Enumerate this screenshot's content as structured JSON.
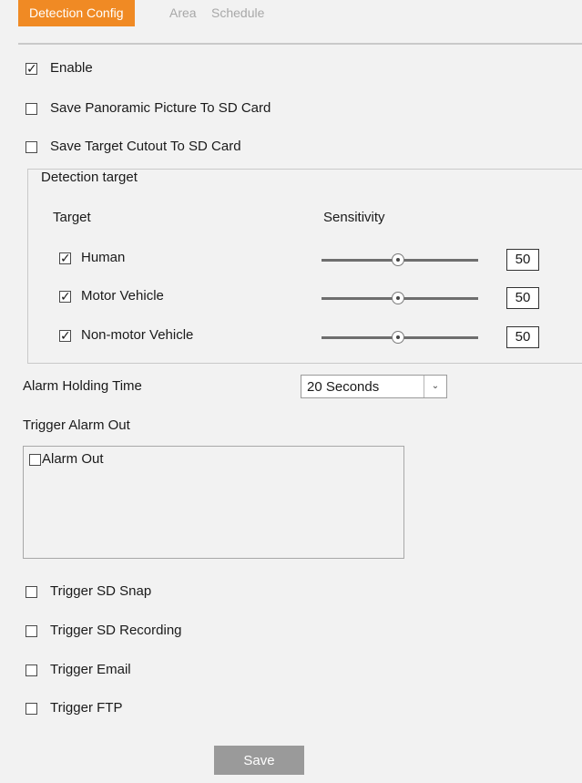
{
  "tabs": [
    {
      "label": "Detection Config",
      "active": true
    },
    {
      "label": "Area",
      "active": false
    },
    {
      "label": "Schedule",
      "active": false
    }
  ],
  "options": {
    "enable": {
      "label": "Enable",
      "checked": true
    },
    "save_panoramic": {
      "label": "Save Panoramic Picture To SD Card",
      "checked": false
    },
    "save_cutout": {
      "label": "Save Target Cutout To SD Card",
      "checked": false
    }
  },
  "detection": {
    "legend": "Detection target",
    "col_target": "Target",
    "col_sensitivity": "Sensitivity",
    "targets": [
      {
        "label": "Human",
        "checked": true,
        "sensitivity": "50"
      },
      {
        "label": "Motor Vehicle",
        "checked": true,
        "sensitivity": "50"
      },
      {
        "label": "Non-motor Vehicle",
        "checked": true,
        "sensitivity": "50"
      }
    ]
  },
  "alarm_holding": {
    "label": "Alarm Holding Time",
    "value": "20 Seconds"
  },
  "trigger_alarm_out": {
    "label": "Trigger Alarm Out",
    "item_label": "Alarm Out",
    "checked": false
  },
  "triggers": {
    "sd_snap": {
      "label": "Trigger SD Snap",
      "checked": false
    },
    "sd_recording": {
      "label": "Trigger SD Recording",
      "checked": false
    },
    "email": {
      "label": "Trigger Email",
      "checked": false
    },
    "ftp": {
      "label": "Trigger FTP",
      "checked": false
    }
  },
  "save_label": "Save",
  "colors": {
    "accent": "#f08a24",
    "background": "#f2f2f2",
    "button": "#9a9a9a"
  },
  "icons": {
    "checkbox_checked": "check-icon",
    "dropdown": "chevron-down-icon",
    "slider": "slider-thumb-icon"
  }
}
